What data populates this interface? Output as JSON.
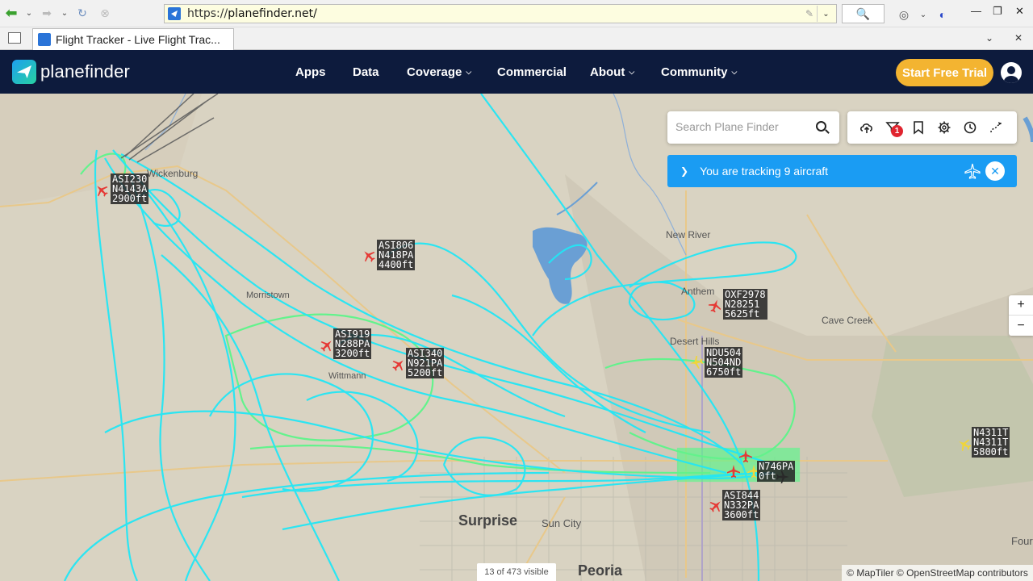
{
  "browser": {
    "url_scheme": "https://",
    "url_host": "planefinder.net/",
    "tab_title": "Flight Tracker - Live Flight Trac..."
  },
  "site": {
    "logo": "planefinder",
    "nav": [
      "Apps",
      "Data",
      "Coverage",
      "Commercial",
      "About",
      "Community"
    ],
    "cta": "Start Free Trial"
  },
  "map": {
    "search_placeholder": "Search Plane Finder",
    "alert_count": "1",
    "tracking_text": "You are tracking 9 aircraft",
    "visible_count": "13 of 473 visible",
    "attribution": "© MapTiler © OpenStreetMap contributors",
    "zoom_in": "+",
    "zoom_out": "−",
    "places": [
      "Wickenburg",
      "Morristown",
      "Wittmann",
      "New River",
      "Anthem",
      "Desert Hills",
      "Cave Creek",
      "Surprise",
      "Sun City",
      "Peoria",
      "Four"
    ],
    "aircraft": [
      {
        "callsign": "ASI230",
        "reg": "N4143A",
        "alt": "2900ft"
      },
      {
        "callsign": "ASI806",
        "reg": "N418PA",
        "alt": "4400ft"
      },
      {
        "callsign": "ASI919",
        "reg": "N288PA",
        "alt": "3200ft"
      },
      {
        "callsign": "ASI340",
        "reg": "N921PA",
        "alt": "5200ft"
      },
      {
        "callsign": "OXF2978",
        "reg": "N28251",
        "alt": "5625ft"
      },
      {
        "callsign": "NDU504",
        "reg": "N504ND",
        "alt": "6750ft"
      },
      {
        "callsign": "N746PA",
        "reg": "",
        "alt": "0ft"
      },
      {
        "callsign": "ASI844",
        "reg": "N332PA",
        "alt": "3600ft"
      },
      {
        "callsign": "N4311T",
        "reg": "N4311T",
        "alt": "5800ft"
      }
    ],
    "colors": {
      "track": "#22e6f5",
      "track_low": "#5df58a",
      "plane_red": "#e53935",
      "plane_yellow": "#f0d53a",
      "nav_bg": "#0d1b3d",
      "cta": "#f3b431",
      "tracking_bar": "#1a9cf3"
    }
  }
}
